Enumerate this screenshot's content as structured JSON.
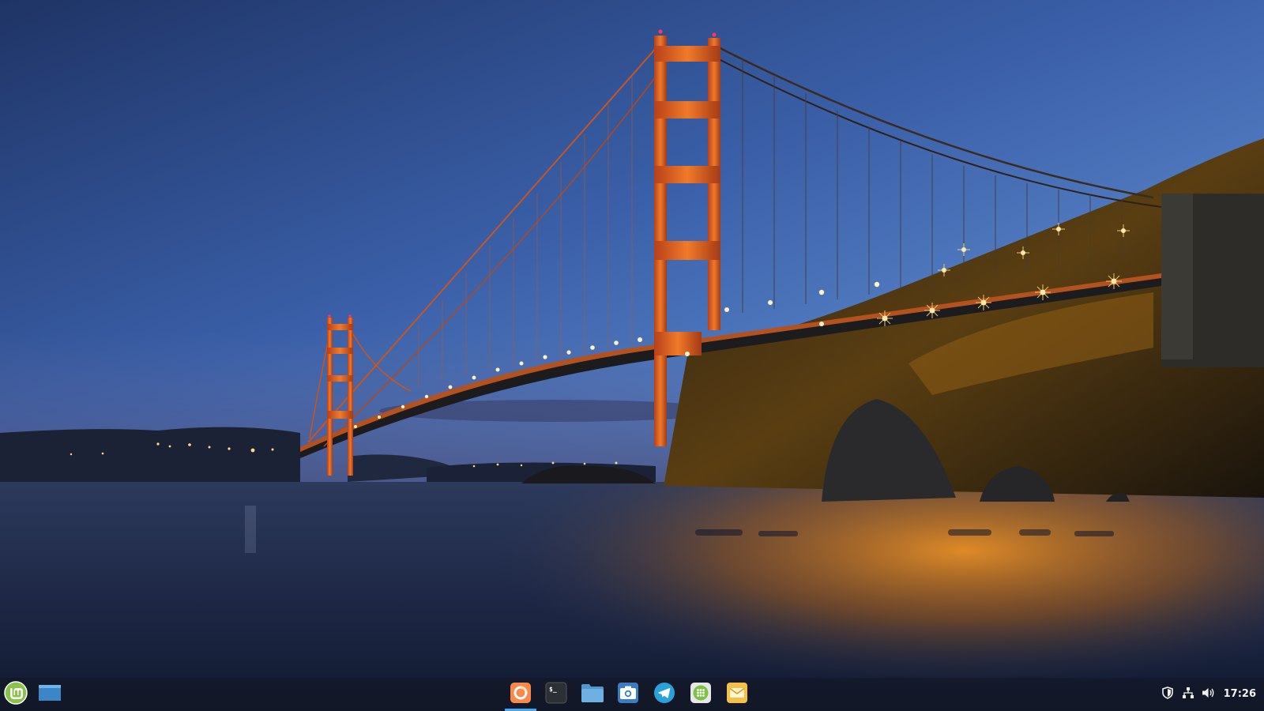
{
  "desktop": {
    "wallpaper": "golden-gate-bridge-at-dusk"
  },
  "panel": {
    "menu_icon": "linux-mint-logo-icon",
    "show_desktop_icon": "show-desktop-icon",
    "launchers": [
      {
        "name": "firefox",
        "icon": "firefox-icon",
        "running": true
      },
      {
        "name": "terminal",
        "icon": "terminal-icon",
        "running": false
      },
      {
        "name": "files",
        "icon": "folder-icon",
        "running": false
      },
      {
        "name": "screenshot",
        "icon": "camera-icon",
        "running": false
      },
      {
        "name": "telegram",
        "icon": "telegram-icon",
        "running": false
      },
      {
        "name": "calculator",
        "icon": "calculator-icon",
        "running": false
      },
      {
        "name": "mail",
        "icon": "mail-icon",
        "running": false
      }
    ],
    "tray": {
      "icons": [
        "shield-icon",
        "network-icon",
        "volume-icon"
      ],
      "clock": "17:26"
    }
  },
  "colors": {
    "mint_green": "#8bc34a",
    "panel_bg": "#12161f",
    "active_indicator": "#3ea8f0",
    "firefox_orange": "#f7894a",
    "telegram_blue": "#2aa1da"
  }
}
